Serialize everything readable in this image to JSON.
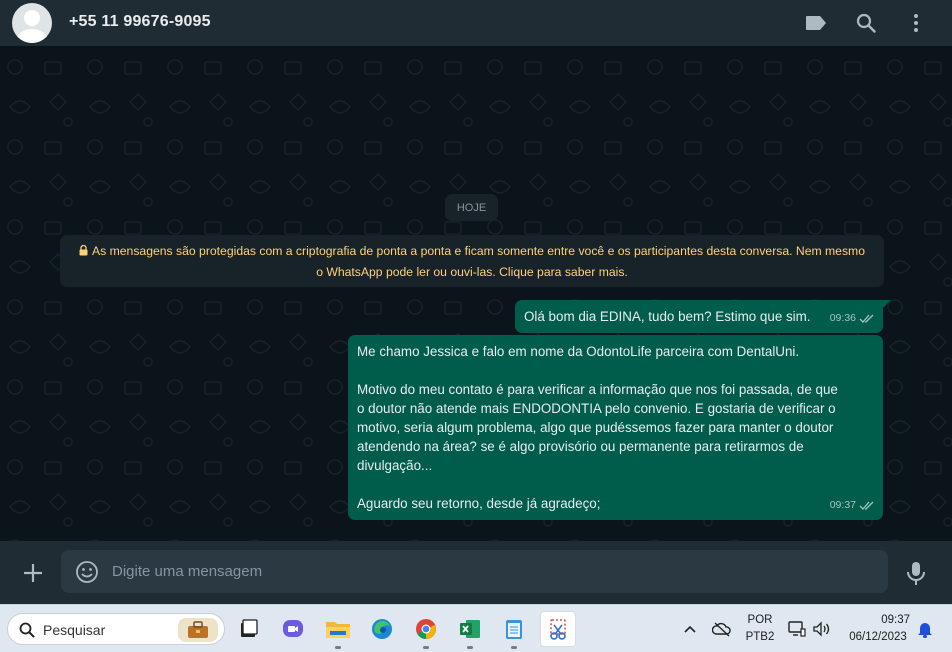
{
  "header": {
    "contact_name": "+55 11 99676-9095",
    "icons": [
      "avatar",
      "label-icon",
      "search-icon",
      "menu-icon"
    ]
  },
  "chat": {
    "date_separator": "HOJE",
    "encryption_notice_line1": "As mensagens são protegidas com a criptografia de ponta a ponta e ficam somente entre você e os participantes desta conversa. Nem mesmo",
    "encryption_notice_line2": "o WhatsApp pode ler ou ouvi-las. Clique para saber mais.",
    "messages": [
      {
        "text": "Olá bom dia EDINA, tudo bem? Estimo que sim.",
        "time": "09:36",
        "status": "delivered"
      },
      {
        "text": "Me chamo Jessica e falo em nome da OdontoLife parceira com DentalUni.\n\nMotivo do meu contato é para verificar a informação que nos foi passada, de que\no doutor não atende mais ENDODONTIA pelo convenio. E gostaria de verificar o\nmotivo, seria algum problema, algo que pudéssemos fazer para manter o doutor\natendendo na área? se é algo provisório ou permanente para retirarmos de\ndivulgação...\n\nAguardo seu retorno, desde já agradeço;",
        "time": "09:37",
        "status": "delivered"
      }
    ]
  },
  "composer": {
    "placeholder": "Digite uma mensagem"
  },
  "taskbar": {
    "search_label": "Pesquisar",
    "apps": [
      "briefcase-app",
      "task-view",
      "teams-chat",
      "file-explorer",
      "edge-browser",
      "chrome-browser",
      "excel",
      "notepad",
      "snipping-tool"
    ],
    "language_line1": "POR",
    "language_line2": "PTB2",
    "clock_time": "09:37",
    "clock_date": "06/12/2023"
  },
  "colors": {
    "header_bg": "#202c33",
    "chat_bg": "#0b141a",
    "outgoing_bubble": "#005c4b",
    "notice_text": "#ffd279",
    "taskbar_bg": "#dfe8f0"
  }
}
